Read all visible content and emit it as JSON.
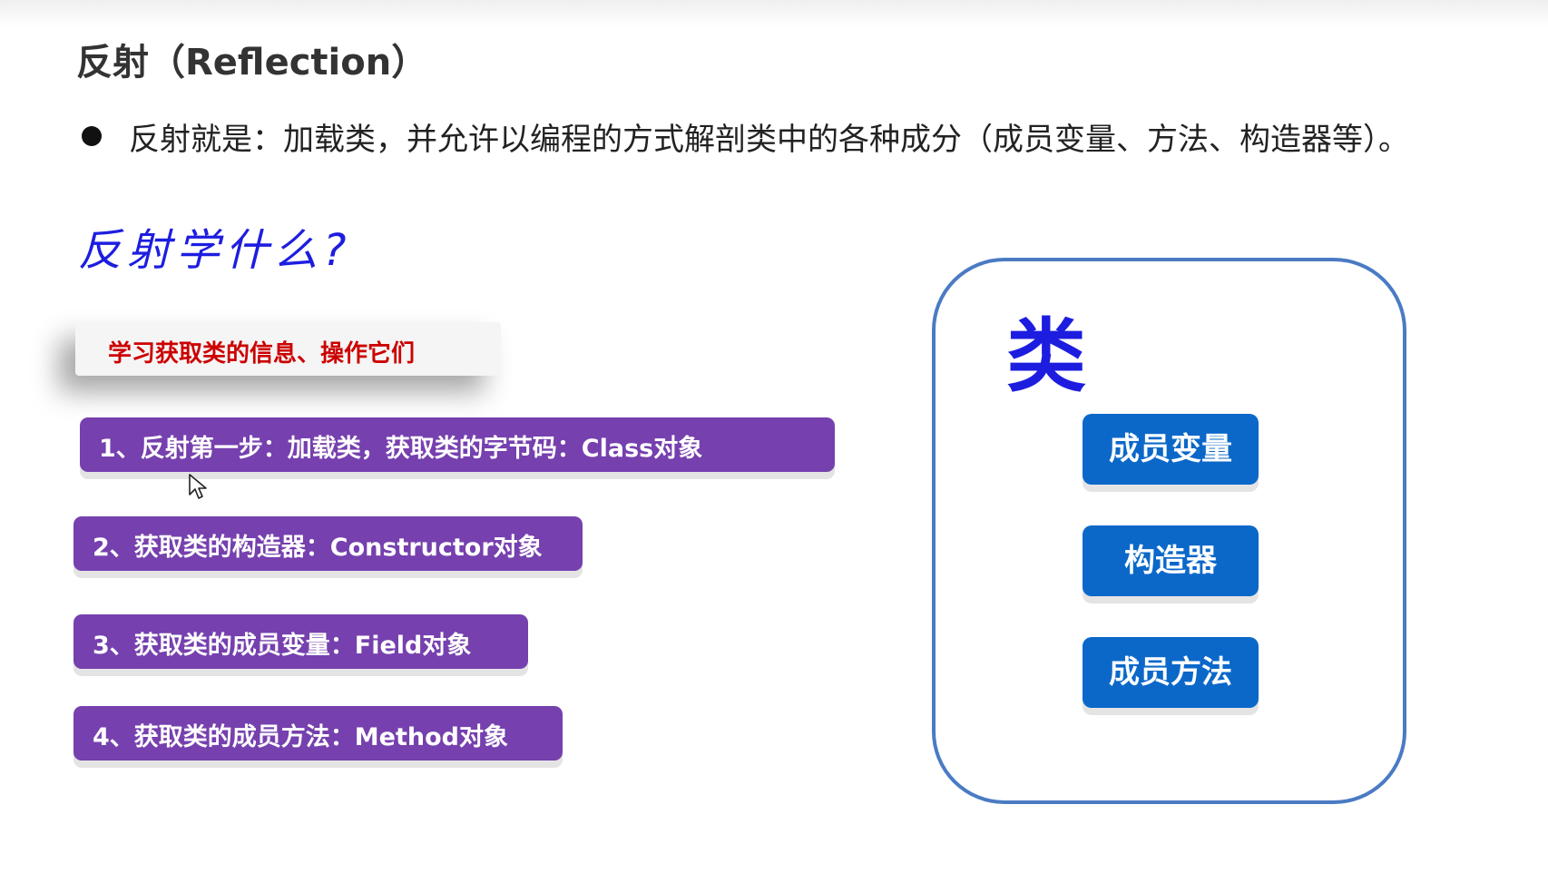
{
  "slide": {
    "title": "反射（Reflection）",
    "definition": "反射就是：加载类，并允许以编程的方式解剖类中的各种成分（成员变量、方法、构造器等）。",
    "question": "反射学什么?",
    "learn_label": "学习获取类的信息、操作它们",
    "steps": [
      "1、反射第一步：加载类，获取类的字节码：Class对象",
      "2、获取类的构造器：Constructor对象",
      "3、获取类的成员变量：Field对象",
      "4、获取类的成员方法：Method对象"
    ],
    "class_box": {
      "label": "类",
      "members": [
        "成员变量",
        "构造器",
        "成员方法"
      ]
    }
  },
  "colors": {
    "step_bg": "#7640ae",
    "member_bg": "#0b68c9",
    "class_border": "#4a7bc4",
    "handwritten": "#1d1de0",
    "learn_text": "#cc0000"
  },
  "icons": {
    "bullet": "bullet-dot-icon",
    "cursor": "mouse-pointer-icon"
  }
}
